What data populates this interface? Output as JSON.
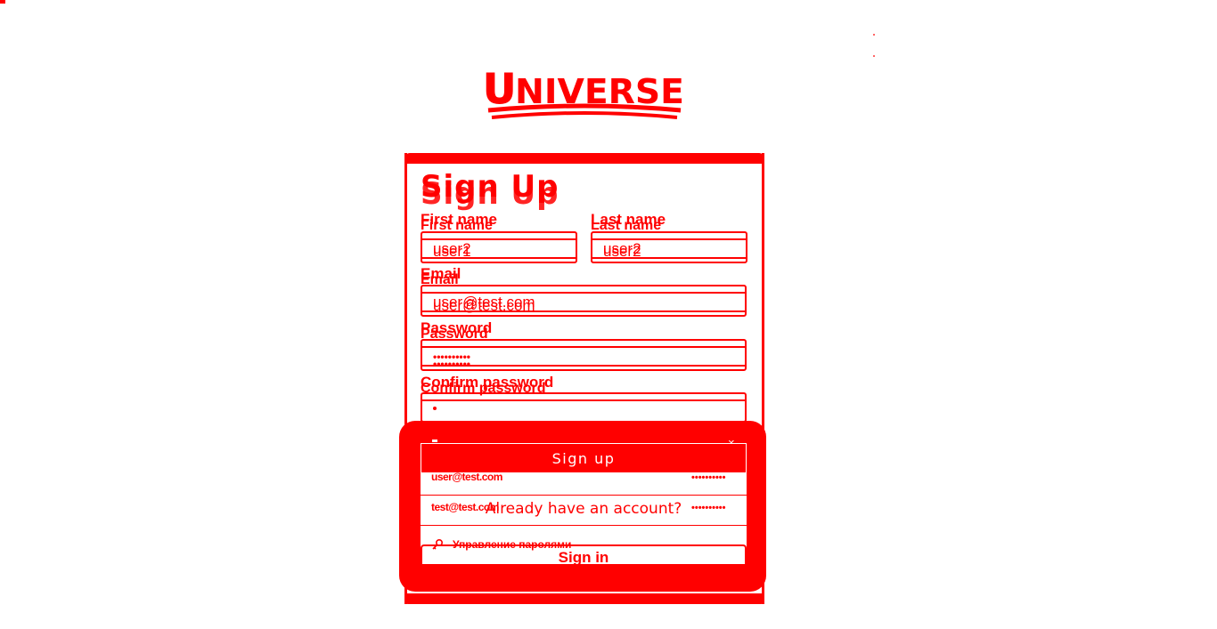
{
  "brand": {
    "logo_text": "UNIVERSE",
    "accent": "#ff0000",
    "background": "#ffffff"
  },
  "form": {
    "title": "Sign Up",
    "first_name": {
      "label": "First name",
      "value": "user1",
      "ghost_value": "user2"
    },
    "last_name": {
      "label": "Last name",
      "value": "user2",
      "ghost_value": "user2"
    },
    "email": {
      "label": "Email",
      "value": "user@test.com"
    },
    "password": {
      "label": "Password",
      "value": "••••••••••"
    },
    "confirm_password": {
      "label": "Confirm password",
      "value": ""
    },
    "submit_label": "Sign up",
    "already_text": "Already have an account?",
    "signin_label": "Sign in"
  },
  "autofill": {
    "close_label": "×",
    "entries": [
      {
        "email": "user@test.com",
        "password": "••••••••••"
      },
      {
        "email": "test@test.com",
        "password": "••••••••••"
      }
    ],
    "manage_label": "Управление паролями",
    "icons": {
      "manage": "key-icon"
    }
  }
}
